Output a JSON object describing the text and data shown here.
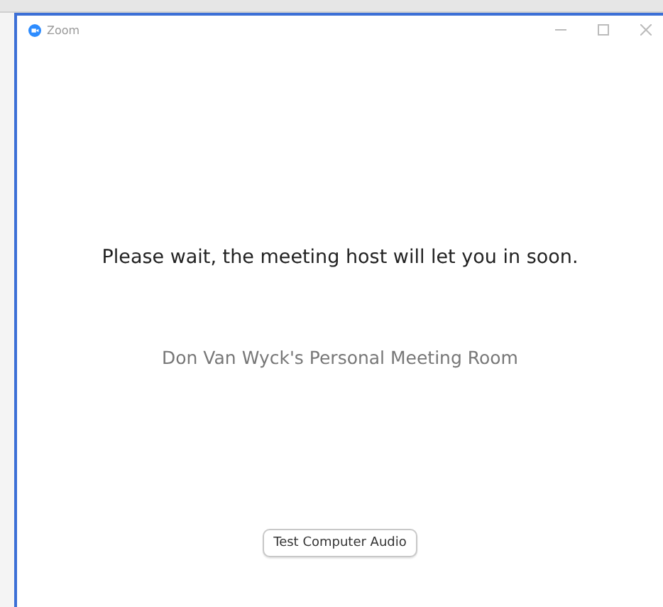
{
  "window": {
    "title": "Zoom"
  },
  "message": "Please wait, the meeting host will let you in soon.",
  "room_name": "Don Van Wyck's Personal Meeting Room",
  "buttons": [
    "Test Computer Audio"
  ]
}
